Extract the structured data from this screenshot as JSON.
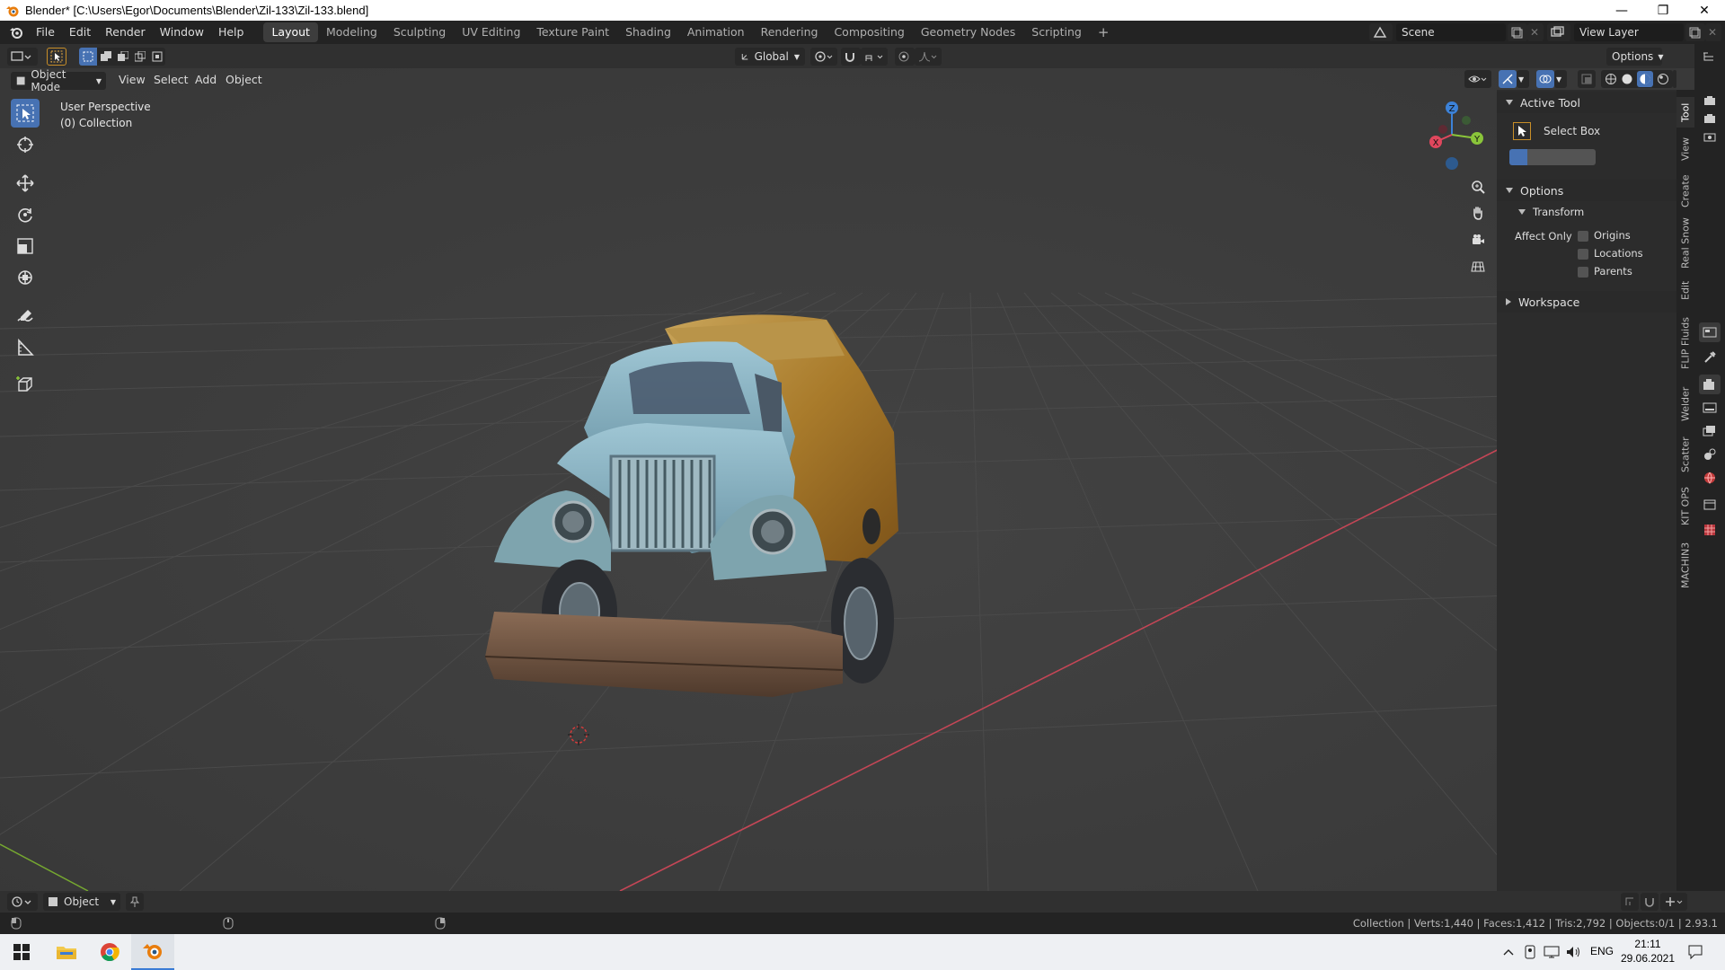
{
  "window": {
    "title": "Blender* [C:\\Users\\Egor\\Documents\\Blender\\Zil-133\\Zil-133.blend]",
    "min": "—",
    "restore": "❐",
    "close": "✕"
  },
  "menu": [
    "File",
    "Edit",
    "Render",
    "Window",
    "Help"
  ],
  "workspaces": [
    "Layout",
    "Modeling",
    "Sculpting",
    "UV Editing",
    "Texture Paint",
    "Shading",
    "Animation",
    "Rendering",
    "Compositing",
    "Geometry Nodes",
    "Scripting"
  ],
  "workspace_add": "+",
  "scene": {
    "name": "Scene",
    "view_layer": "View Layer"
  },
  "tool_header": {
    "transform_orientation": "Global",
    "options": "Options"
  },
  "viewport_header": {
    "mode": "Object Mode",
    "menus": [
      "View",
      "Select",
      "Add",
      "Object"
    ]
  },
  "viewport": {
    "perspective": "User Perspective",
    "collection": "(0) Collection"
  },
  "gizmo": {
    "z": "Z",
    "y": "Y",
    "x": "X"
  },
  "npanel": {
    "active_tool_title": "Active Tool",
    "active_tool_name": "Select Box",
    "options_title": "Options",
    "transform_title": "Transform",
    "affect_only": "Affect Only",
    "affect": [
      "Origins",
      "Locations",
      "Parents"
    ],
    "workspace_title": "Workspace"
  },
  "vtabs": [
    "Tool",
    "View",
    "Create",
    "Real Snow",
    "Edit",
    "FLIP Fluids",
    "Welder",
    "Scatter",
    "KIT OPS",
    "MACHIN3"
  ],
  "timeline": {
    "mode": "Object"
  },
  "status": {
    "stats": "Collection | Verts:1,440 | Faces:1,412 | Tris:2,792 | Objects:0/1 | 2.93.1"
  },
  "taskbar": {
    "lang": "ENG",
    "time": "21:11",
    "date": "29.06.2021"
  },
  "colors": {
    "accent": "#4772b3",
    "axis_x": "#e0475d",
    "axis_y": "#8ac53a",
    "axis_z": "#3c82d8"
  }
}
